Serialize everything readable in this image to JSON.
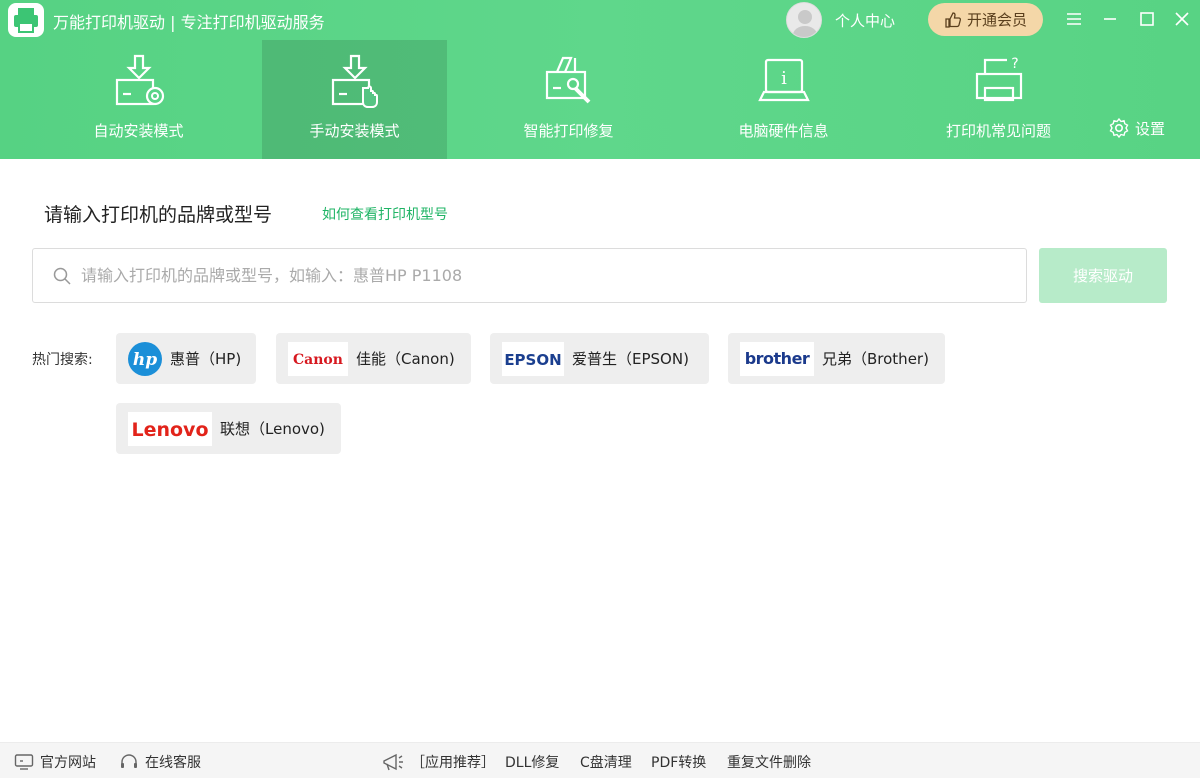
{
  "app": {
    "title": "万能打印机驱动 | 专注打印机驱动服务",
    "user_center": "个人中心",
    "vip_label": "开通会员"
  },
  "nav": {
    "items": [
      {
        "label": "自动安装模式",
        "icon": "auto-install-icon",
        "active": false
      },
      {
        "label": "手动安装模式",
        "icon": "manual-install-icon",
        "active": true
      },
      {
        "label": "智能打印修复",
        "icon": "print-repair-icon",
        "active": false
      },
      {
        "label": "电脑硬件信息",
        "icon": "hardware-info-icon",
        "active": false
      },
      {
        "label": "打印机常见问题",
        "icon": "printer-faq-icon",
        "active": false
      }
    ],
    "settings_label": "设置"
  },
  "main": {
    "title": "请输入打印机的品牌或型号",
    "how_link": "如何查看打印机型号",
    "search_placeholder": "请输入打印机的品牌或型号，如输入：惠普HP P1108",
    "search_value": "",
    "search_button": "搜索驱动",
    "hot_label": "热门搜索:",
    "hot_brands": [
      {
        "label": "惠普（HP)",
        "logo": "hp-logo"
      },
      {
        "label": "佳能（Canon)",
        "logo": "canon-logo"
      },
      {
        "label": "爱普生（EPSON)",
        "logo": "epson-logo"
      },
      {
        "label": "兄弟（Brother)",
        "logo": "brother-logo"
      },
      {
        "label": "联想（Lenovo)",
        "logo": "lenovo-logo"
      }
    ]
  },
  "footer": {
    "website": "官方网站",
    "support": "在线客服",
    "app_recommend": "［应用推荐］",
    "dll_fix": "DLL修复",
    "c_clean": "C盘清理",
    "pdf_convert": "PDF转换",
    "dup_delete": "重复文件删除"
  },
  "colors": {
    "brand_green": "#5ad487",
    "link_green": "#1fb465",
    "vip_gold": "#f4d7a8",
    "search_button_disabled": "#b7ebc9"
  }
}
